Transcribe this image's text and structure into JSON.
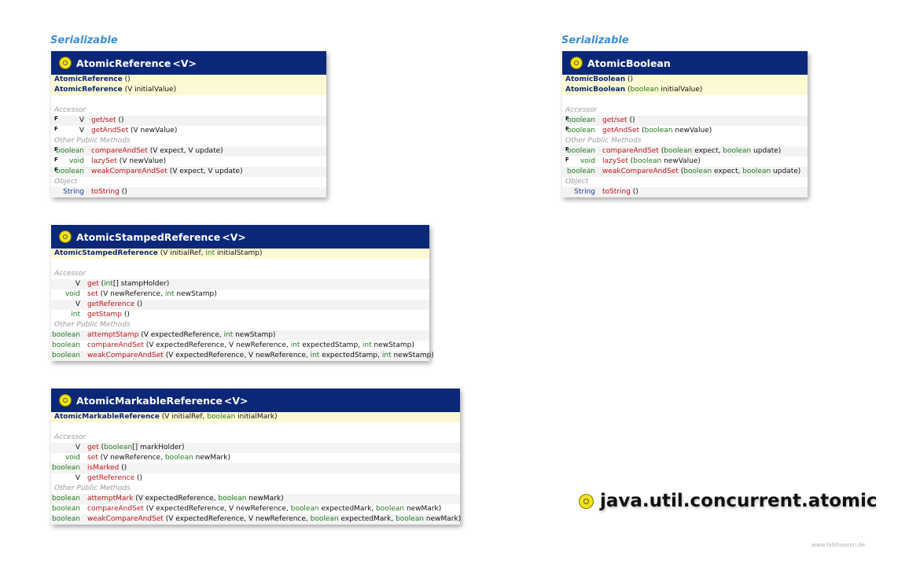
{
  "colors": {
    "header_bg": "#0b2878",
    "interface_label": "#3a8ed6",
    "constructor_bg": "#fdf9d3",
    "method_name": "#c0141a",
    "keyword_type": "#1f7a1f"
  },
  "icons": {
    "class_icon": "class-circle-icon"
  },
  "classes": {
    "atomic_reference": {
      "interface": "Serializable",
      "title": "AtomicReference",
      "generic": "<V>",
      "constructors": [
        {
          "name": "AtomicReference",
          "params": "()"
        },
        {
          "name": "AtomicReference",
          "params": "(V initialValue)"
        }
      ],
      "sections": [
        {
          "label": "Accessor",
          "methods": [
            {
              "final": "F",
              "type": "V",
              "name": "get/set",
              "params": "()"
            },
            {
              "final": "F",
              "type": "V",
              "name": "getAndSet",
              "params": "(V newValue)"
            }
          ]
        },
        {
          "label": "Other Public Methods",
          "methods": [
            {
              "final": "F",
              "type": "boolean",
              "name": "compareAndSet",
              "params": "(V expect, V update)"
            },
            {
              "final": "F",
              "type": "void",
              "name": "lazySet",
              "params": "(V newValue)"
            },
            {
              "final": "F",
              "type": "boolean",
              "name": "weakCompareAndSet",
              "params": "(V expect, V update)"
            }
          ]
        },
        {
          "label": "Object",
          "methods": [
            {
              "final": "",
              "type": "String",
              "name": "toString",
              "params": "()"
            }
          ]
        }
      ]
    },
    "atomic_boolean": {
      "interface": "Serializable",
      "title": "AtomicBoolean",
      "generic": "",
      "constructors": [
        {
          "name": "AtomicBoolean",
          "params": "()"
        },
        {
          "name": "AtomicBoolean",
          "params": "(boolean initialValue)"
        }
      ],
      "sections": [
        {
          "label": "Accessor",
          "methods": [
            {
              "final": "F",
              "type": "boolean",
              "name": "get/set",
              "params": "()"
            },
            {
              "final": "F",
              "type": "boolean",
              "name": "getAndSet",
              "params": "(boolean newValue)"
            }
          ]
        },
        {
          "label": "Other Public Methods",
          "methods": [
            {
              "final": "F",
              "type": "boolean",
              "name": "compareAndSet",
              "params": "(boolean expect, boolean update)"
            },
            {
              "final": "F",
              "type": "void",
              "name": "lazySet",
              "params": "(boolean newValue)"
            },
            {
              "final": "",
              "type": "boolean",
              "name": "weakCompareAndSet",
              "params": "(boolean expect, boolean update)"
            }
          ]
        },
        {
          "label": "Object",
          "methods": [
            {
              "final": "",
              "type": "String",
              "name": "toString",
              "params": "()"
            }
          ]
        }
      ]
    },
    "atomic_stamped_reference": {
      "interface": "",
      "title": "AtomicStampedReference",
      "generic": "<V>",
      "constructors": [
        {
          "name": "AtomicStampedReference",
          "params": "(V initialRef, int initialStamp)"
        }
      ],
      "sections": [
        {
          "label": "Accessor",
          "methods": [
            {
              "final": "",
              "type": "V",
              "name": "get",
              "params": "(int[] stampHolder)"
            },
            {
              "final": "",
              "type": "void",
              "name": "set",
              "params": "(V newReference, int newStamp)"
            },
            {
              "final": "",
              "type": "V",
              "name": "getReference",
              "params": "()"
            },
            {
              "final": "",
              "type": "int",
              "name": "getStamp",
              "params": "()"
            }
          ]
        },
        {
          "label": "Other Public Methods",
          "methods": [
            {
              "final": "",
              "type": "boolean",
              "name": "attemptStamp",
              "params": "(V expectedReference, int newStamp)"
            },
            {
              "final": "",
              "type": "boolean",
              "name": "compareAndSet",
              "params": "(V expectedReference, V newReference, int expectedStamp, int newStamp)"
            },
            {
              "final": "",
              "type": "boolean",
              "name": "weakCompareAndSet",
              "params": "(V expectedReference, V newReference, int expectedStamp, int newStamp)"
            }
          ]
        }
      ]
    },
    "atomic_markable_reference": {
      "interface": "",
      "title": "AtomicMarkableReference",
      "generic": "<V>",
      "constructors": [
        {
          "name": "AtomicMarkableReference",
          "params": "(V initialRef, boolean initialMark)"
        }
      ],
      "sections": [
        {
          "label": "Accessor",
          "methods": [
            {
              "final": "",
              "type": "V",
              "name": "get",
              "params": "(boolean[] markHolder)"
            },
            {
              "final": "",
              "type": "void",
              "name": "set",
              "params": "(V newReference, boolean newMark)"
            },
            {
              "final": "",
              "type": "boolean",
              "name": "isMarked",
              "params": "()"
            },
            {
              "final": "",
              "type": "V",
              "name": "getReference",
              "params": "()"
            }
          ]
        },
        {
          "label": "Other Public Methods",
          "methods": [
            {
              "final": "",
              "type": "boolean",
              "name": "attemptMark",
              "params": "(V expectedReference, boolean newMark)"
            },
            {
              "final": "",
              "type": "boolean",
              "name": "compareAndSet",
              "params": "(V expectedReference, V newReference, boolean expectedMark, boolean newMark)"
            },
            {
              "final": "",
              "type": "boolean",
              "name": "weakCompareAndSet",
              "params": "(V expectedReference, V newReference, boolean expectedMark, boolean newMark)"
            }
          ]
        }
      ]
    }
  },
  "package": {
    "name": "java.util.concurrent.atomic"
  },
  "credit": "www.falkhausen.de"
}
